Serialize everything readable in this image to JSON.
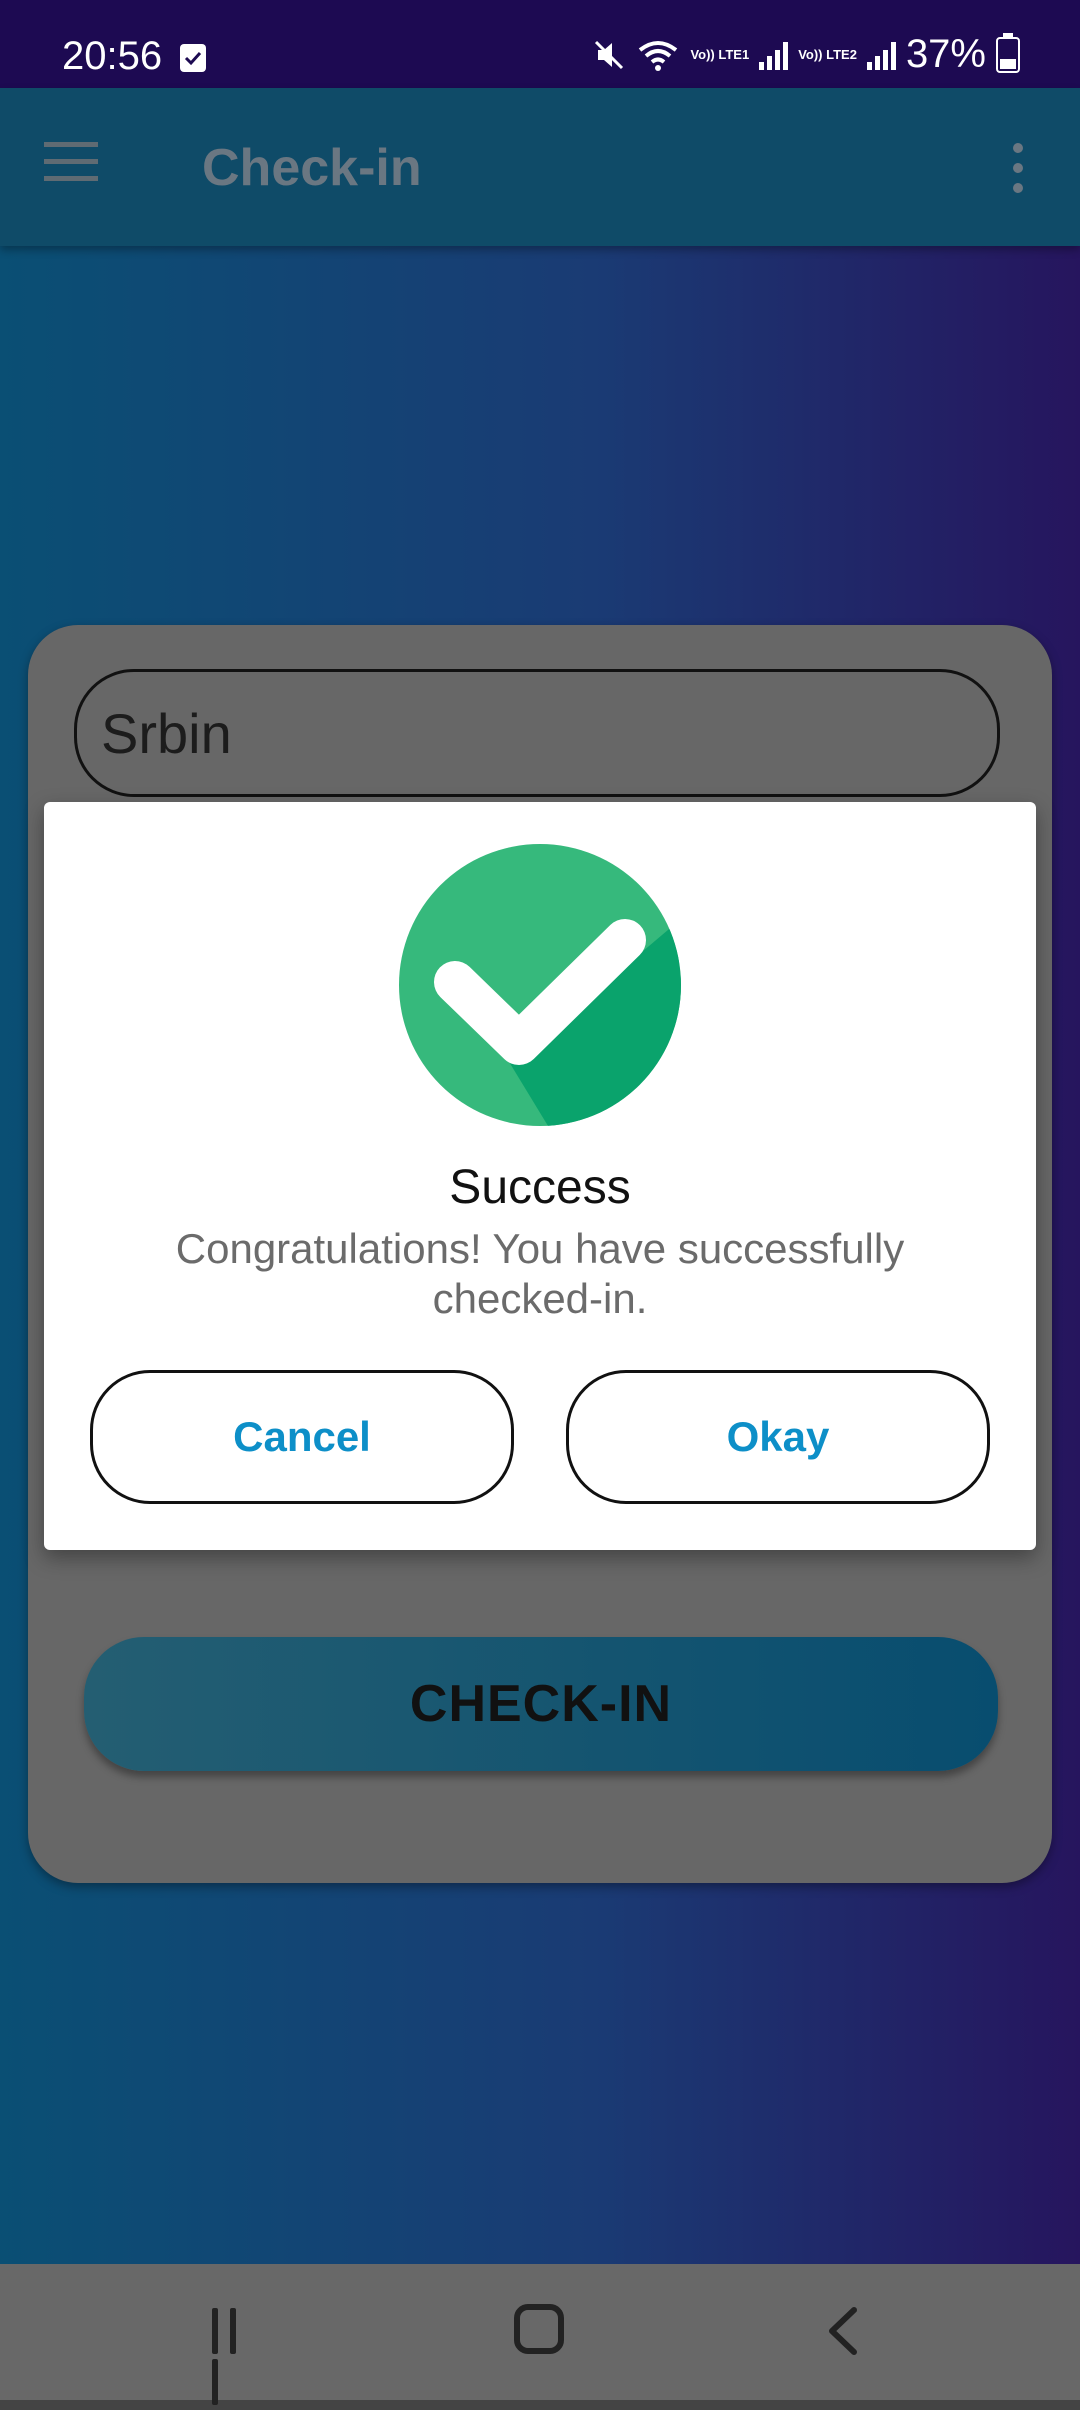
{
  "status_bar": {
    "time": "20:56",
    "battery": "37%",
    "sim1_label": "Vo)) LTE1",
    "sim2_label": "Vo)) LTE2",
    "icons": [
      "notification-check-icon",
      "mute-icon",
      "wifi-icon",
      "signal-icon",
      "battery-icon"
    ]
  },
  "toolbar": {
    "title": "Check-in",
    "menu_icon": "hamburger-icon",
    "overflow_icon": "more-vert-icon"
  },
  "form": {
    "name_value": "Srbin",
    "checkin_label": "CHECK-IN"
  },
  "dialog": {
    "icon": "success-check-icon",
    "title": "Success",
    "message": "Congratulations! You have successfully checked-in.",
    "cancel_label": "Cancel",
    "okay_label": "Okay"
  },
  "nav_bar": {
    "icons": [
      "recents-icon",
      "home-icon",
      "back-icon"
    ]
  },
  "colors": {
    "status_bar": "#1d0a52",
    "toolbar": "#0f4b68",
    "card": "#676767",
    "dialog_button_text": "#0d8fc8",
    "success_green": "#36b97c",
    "success_green_shadow": "#0aa36c"
  }
}
